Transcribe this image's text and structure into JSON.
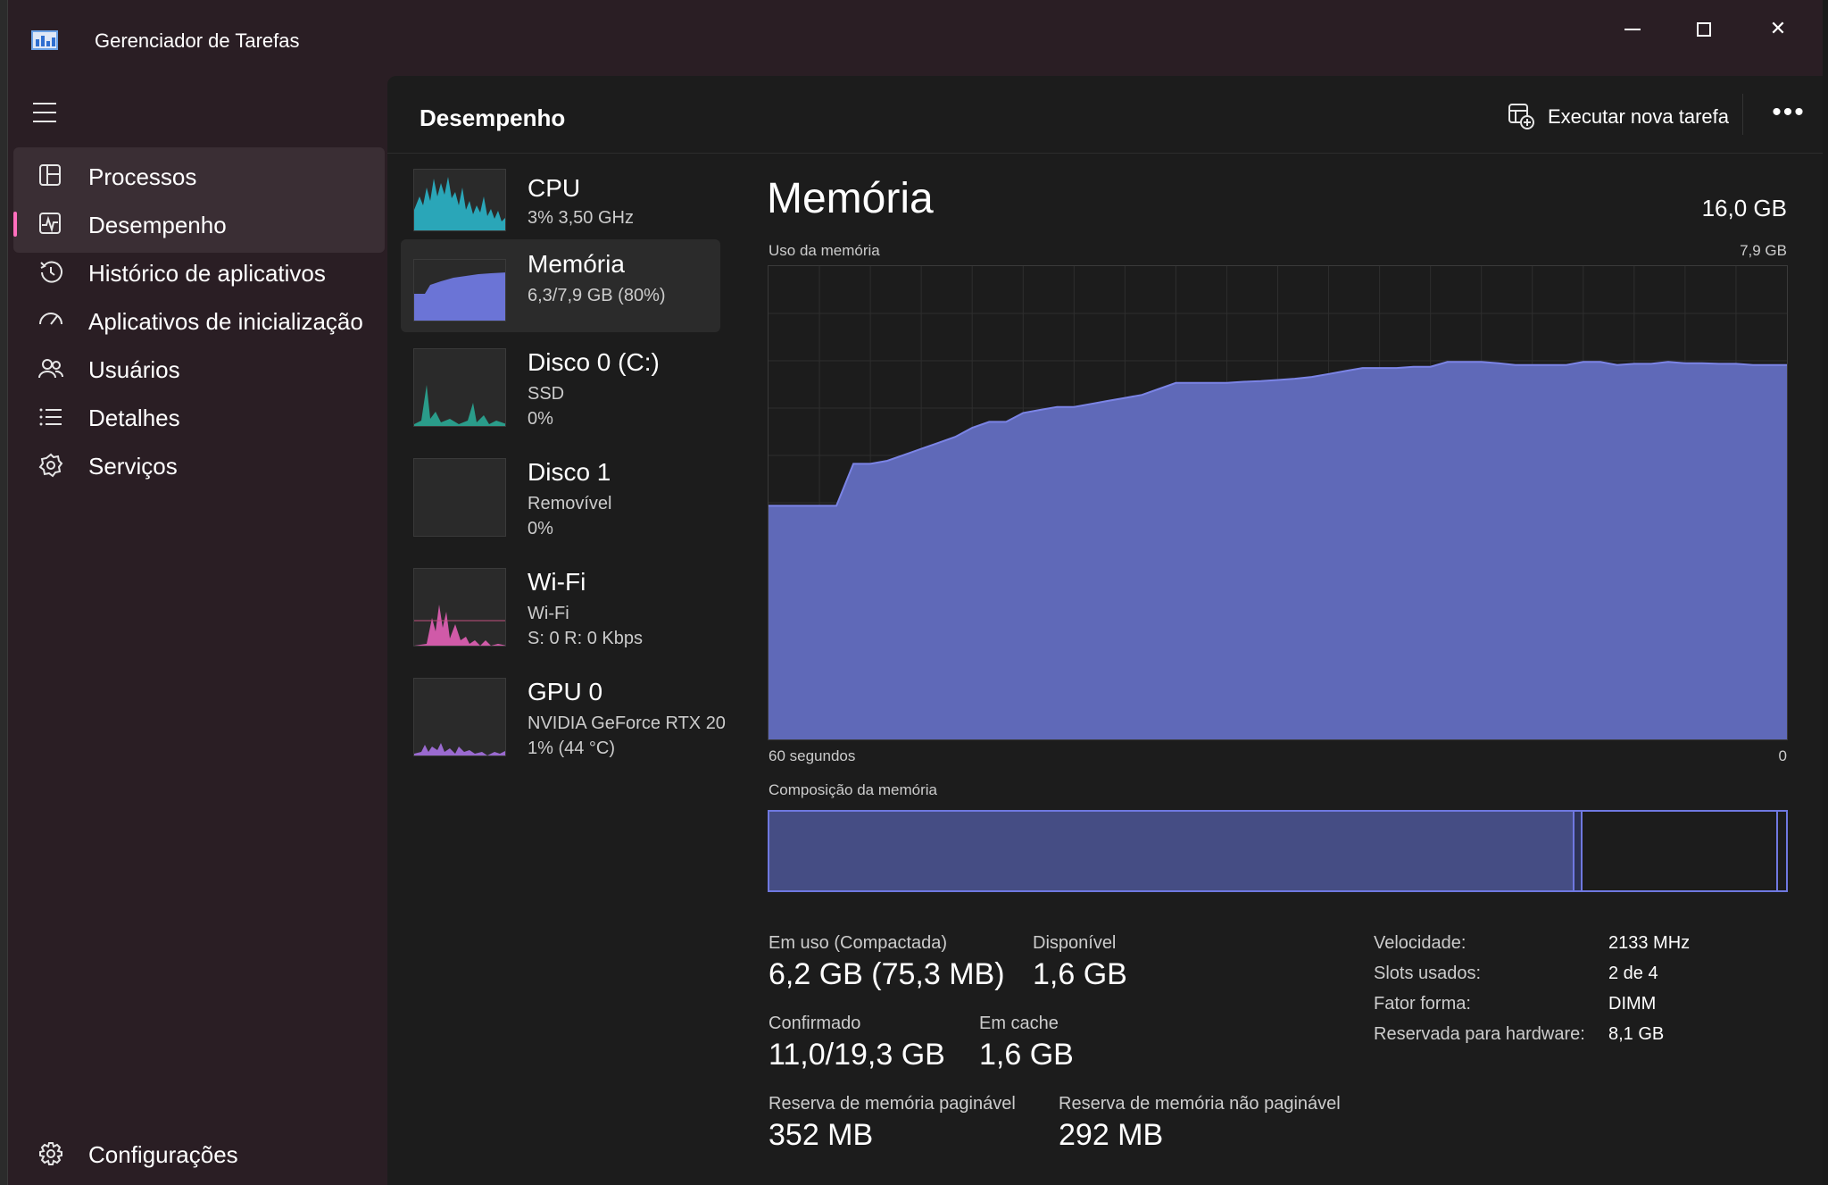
{
  "window": {
    "title": "Gerenciador de Tarefas",
    "controls": [
      "minimize",
      "maximize",
      "close"
    ]
  },
  "sidebar": {
    "items": [
      {
        "label": "Processos",
        "icon": "processes-icon"
      },
      {
        "label": "Desempenho",
        "icon": "performance-icon",
        "selected": true
      },
      {
        "label": "Histórico de aplicativos",
        "icon": "history-icon"
      },
      {
        "label": "Aplicativos de inicialização",
        "icon": "startup-icon"
      },
      {
        "label": "Usuários",
        "icon": "users-icon"
      },
      {
        "label": "Detalhes",
        "icon": "details-icon"
      },
      {
        "label": "Serviços",
        "icon": "services-icon"
      }
    ],
    "settings_label": "Configurações",
    "accent": "#ff6fbd"
  },
  "header": {
    "title": "Desempenho",
    "run_task_label": "Executar nova tarefa",
    "more_label": "•••"
  },
  "perf_list": [
    {
      "name": "CPU",
      "sub1": "3% 3,50 GHz",
      "sub2": "",
      "color": "#2aa6b8"
    },
    {
      "name": "Memória",
      "sub1": "6,3/7,9 GB (80%)",
      "sub2": "",
      "color": "#6b74d6",
      "selected": true
    },
    {
      "name": "Disco 0 (C:)",
      "sub1": "SSD",
      "sub2": "0%",
      "color": "#2a9c8a"
    },
    {
      "name": "Disco 1",
      "sub1": "Removível",
      "sub2": "0%",
      "color": "#2a9c8a"
    },
    {
      "name": "Wi-Fi",
      "sub1": "Wi-Fi",
      "sub2": "S: 0 R: 0 Kbps",
      "color": "#d05aa8"
    },
    {
      "name": "GPU 0",
      "sub1": "NVIDIA GeForce RTX 20",
      "sub2": "1% (44 °C)",
      "color": "#9a6ad0"
    }
  ],
  "detail": {
    "title": "Memória",
    "total": "16,0 GB",
    "chart_label": "Uso da memória",
    "chart_max": "7,9 GB",
    "axis_left": "60 segundos",
    "axis_right": "0",
    "composition_label": "Composição da memória",
    "composition": {
      "in_use_fraction": 0.79,
      "modified_fraction": 0.01,
      "standby_fraction": 0.19
    },
    "stats": [
      {
        "label": "Em uso (Compactada)",
        "value": "6,2 GB (75,3 MB)"
      },
      {
        "label": "Disponível",
        "value": "1,6 GB"
      },
      {
        "label": "Confirmado",
        "value": "11,0/19,3 GB"
      },
      {
        "label": "Em cache",
        "value": "1,6 GB"
      },
      {
        "label": "Reserva de memória paginável",
        "value": "352 MB"
      },
      {
        "label": "Reserva de memória não paginável",
        "value": "292 MB"
      }
    ],
    "specs": [
      {
        "key": "Velocidade:",
        "value": "2133 MHz"
      },
      {
        "key": "Slots usados:",
        "value": "2 de 4"
      },
      {
        "key": "Fator forma:",
        "value": "DIMM"
      },
      {
        "key": "Reservada para hardware:",
        "value": "8,1 GB"
      }
    ],
    "fill_color": "#5f69b8",
    "line_color": "#7b84e6"
  },
  "chart_data": {
    "type": "area",
    "xlabel": "60 segundos",
    "ylabel": "Uso da memória",
    "xlim": [
      60,
      0
    ],
    "ylim": [
      0,
      7.9
    ],
    "x": [
      60,
      59,
      58,
      57,
      56,
      55,
      54,
      53,
      52,
      51,
      50,
      49,
      48,
      47,
      46,
      45,
      44,
      43,
      42,
      41,
      40,
      39,
      38,
      37,
      36,
      35,
      34,
      33,
      32,
      31,
      30,
      29,
      28,
      27,
      26,
      25,
      24,
      23,
      22,
      21,
      20,
      19,
      18,
      17,
      16,
      15,
      14,
      13,
      12,
      11,
      10,
      9,
      8,
      7,
      6,
      5,
      4,
      3,
      2,
      1,
      0
    ],
    "values": [
      3.9,
      3.9,
      3.9,
      3.9,
      3.9,
      4.6,
      4.6,
      4.65,
      4.75,
      4.85,
      4.95,
      5.05,
      5.2,
      5.3,
      5.3,
      5.45,
      5.5,
      5.55,
      5.55,
      5.6,
      5.65,
      5.7,
      5.75,
      5.85,
      5.95,
      5.95,
      5.95,
      5.95,
      5.97,
      5.98,
      6.0,
      6.02,
      6.05,
      6.1,
      6.15,
      6.2,
      6.2,
      6.2,
      6.22,
      6.22,
      6.3,
      6.3,
      6.3,
      6.28,
      6.25,
      6.25,
      6.25,
      6.25,
      6.3,
      6.3,
      6.25,
      6.27,
      6.27,
      6.3,
      6.28,
      6.28,
      6.27,
      6.27,
      6.25,
      6.25,
      6.25
    ]
  }
}
